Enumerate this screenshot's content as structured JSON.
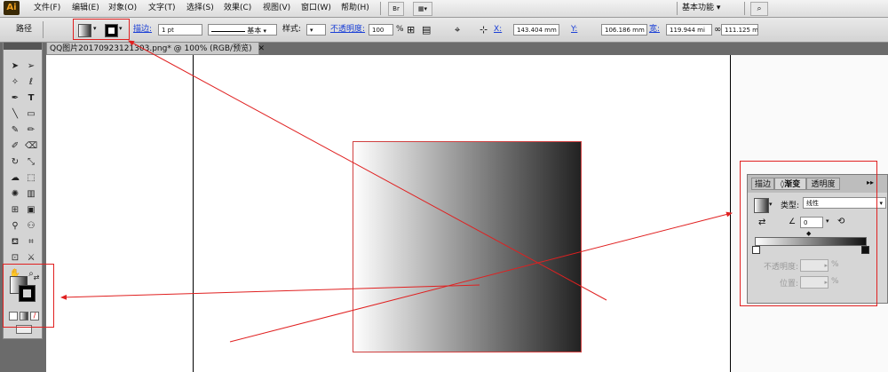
{
  "menubar": {
    "items": [
      "文件(F)",
      "编辑(E)",
      "对象(O)",
      "文字(T)",
      "选择(S)",
      "效果(C)",
      "视图(V)",
      "窗口(W)",
      "帮助(H)"
    ],
    "workspace_label": "基本功能"
  },
  "control_bar": {
    "selection_type": "路径",
    "stroke_label": "描边:",
    "stroke_weight": "1 pt",
    "brush_label": "基本",
    "style_label": "样式:",
    "opacity_label": "不透明度:",
    "opacity_value": "100",
    "opacity_unit": "%",
    "x_label": "X:",
    "x_value": "143.404 mm",
    "y_label": "Y:",
    "y_value": "106.186 mm",
    "width_label": "宽:",
    "width_value": "119.944 mi",
    "height_label": "高:",
    "height_value": "111.125 mi"
  },
  "document": {
    "tab_title": "QQ图片20170923121303.png* @ 100% (RGB/预览)",
    "close_glyph": "✕"
  },
  "gradient_panel": {
    "tabs": [
      "描边",
      "渐变",
      "透明度"
    ],
    "type_label": "类型:",
    "type_value": "线性",
    "angle_value": "0",
    "opacity_label": "不透明度:",
    "opacity_unit": "%",
    "location_label": "位置:",
    "location_unit": "%"
  },
  "colors": {
    "annotation_red": "#e02020",
    "link_blue": "#1a3fd6"
  }
}
